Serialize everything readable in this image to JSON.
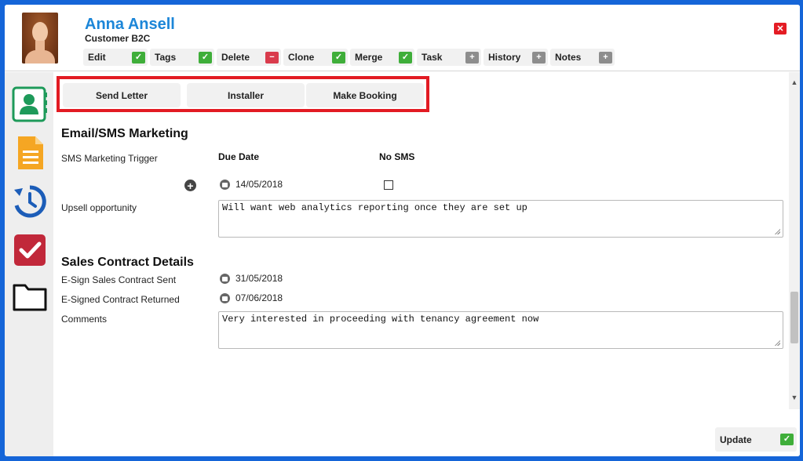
{
  "contact": {
    "name": "Anna Ansell",
    "type": "Customer B2C"
  },
  "actions": [
    {
      "label": "Edit",
      "icon": "check-icon",
      "symbol": "✓"
    },
    {
      "label": "Tags",
      "icon": "check-icon",
      "symbol": "✓"
    },
    {
      "label": "Delete",
      "icon": "minus-icon",
      "symbol": "−"
    },
    {
      "label": "Clone",
      "icon": "check-icon",
      "symbol": "✓"
    },
    {
      "label": "Merge",
      "icon": "check-icon",
      "symbol": "✓"
    },
    {
      "label": "Task",
      "icon": "plus-icon",
      "symbol": "+"
    },
    {
      "label": "History",
      "icon": "plus-icon",
      "symbol": "+"
    },
    {
      "label": "Notes",
      "icon": "plus-icon",
      "symbol": "+"
    }
  ],
  "close_symbol": "✕",
  "tabs": [
    "Send Letter",
    "Installer",
    "Make Booking"
  ],
  "sidebar": {
    "items": [
      "contact-card-icon",
      "document-icon",
      "history-icon",
      "task-icon",
      "folder-icon"
    ]
  },
  "email_sms": {
    "title": "Email/SMS Marketing",
    "trigger_label": "SMS Marketing Trigger",
    "due_date_header": "Due Date",
    "no_sms_header": "No SMS",
    "due_date": "14/05/2018",
    "no_sms_checked": false,
    "upsell_label": "Upsell opportunity",
    "upsell_value": "Will want web analytics reporting once they are set up"
  },
  "sales_contract": {
    "title": "Sales Contract Details",
    "esign_sent_label": "E-Sign Sales Contract Sent",
    "esign_sent_date": "31/05/2018",
    "esigned_returned_label": "E-Signed Contract Returned",
    "esigned_returned_date": "07/06/2018",
    "comments_label": "Comments",
    "comments_value": "Very interested in proceeding with tenancy agreement now"
  },
  "footer": {
    "update_label": "Update",
    "update_symbol": "✓"
  },
  "colors": {
    "accent": "#1c86d8",
    "frame": "#1565d8",
    "highlight": "#e21b23",
    "check_green": "#3fae3a",
    "delete_red": "#d93b4c"
  }
}
